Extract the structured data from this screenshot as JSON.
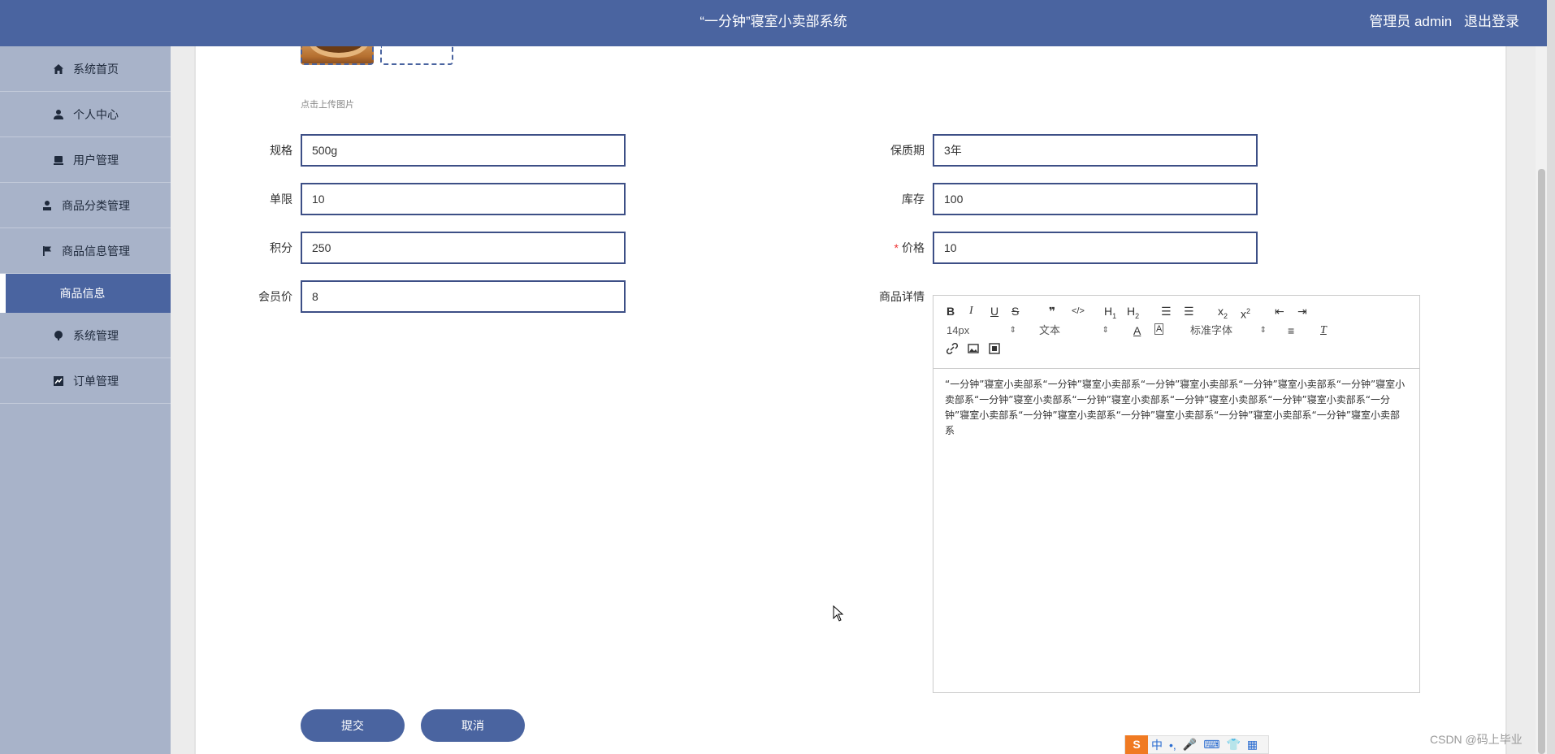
{
  "header": {
    "title": "“一分钟”寝室小卖部系统",
    "user_label": "管理员 admin",
    "logout_label": "退出登录"
  },
  "sidebar": {
    "items": [
      {
        "label": "系统首页",
        "icon": "home-icon"
      },
      {
        "label": "个人中心",
        "icon": "user-icon"
      },
      {
        "label": "用户管理",
        "icon": "users-icon"
      },
      {
        "label": "商品分类管理",
        "icon": "category-icon"
      },
      {
        "label": "商品信息管理",
        "icon": "flag-icon"
      },
      {
        "label": "商品信息",
        "icon": ""
      },
      {
        "label": "系统管理",
        "icon": "settings-icon"
      },
      {
        "label": "订单管理",
        "icon": "chart-icon"
      }
    ]
  },
  "form": {
    "upload_hint": "点击上传图片",
    "spec": {
      "label": "规格",
      "value": "500g"
    },
    "shelf_life": {
      "label": "保质期",
      "value": "3年"
    },
    "limit": {
      "label": "单限",
      "value": "10"
    },
    "stock": {
      "label": "库存",
      "value": "100"
    },
    "points": {
      "label": "积分",
      "value": "250"
    },
    "price": {
      "label": "价格",
      "value": "10",
      "required_mark": "*"
    },
    "member_price": {
      "label": "会员价",
      "value": "8"
    },
    "detail": {
      "label": "商品详情"
    }
  },
  "editor": {
    "font_size": "14px",
    "text_type": "文本",
    "font_family": "标准字体",
    "content": "“一分钟”寝室小卖部系“一分钟”寝室小卖部系“一分钟”寝室小卖部系“一分钟”寝室小卖部系“一分钟”寝室小卖部系“一分钟”寝室小卖部系“一分钟”寝室小卖部系“一分钟”寝室小卖部系“一分钟”寝室小卖部系“一分钟”寝室小卖部系“一分钟”寝室小卖部系“一分钟”寝室小卖部系“一分钟”寝室小卖部系“一分钟”寝室小卖部系"
  },
  "buttons": {
    "submit": "提交",
    "cancel": "取消"
  },
  "ime": {
    "chinese": "中"
  },
  "watermark": "CSDN @码上毕业"
}
